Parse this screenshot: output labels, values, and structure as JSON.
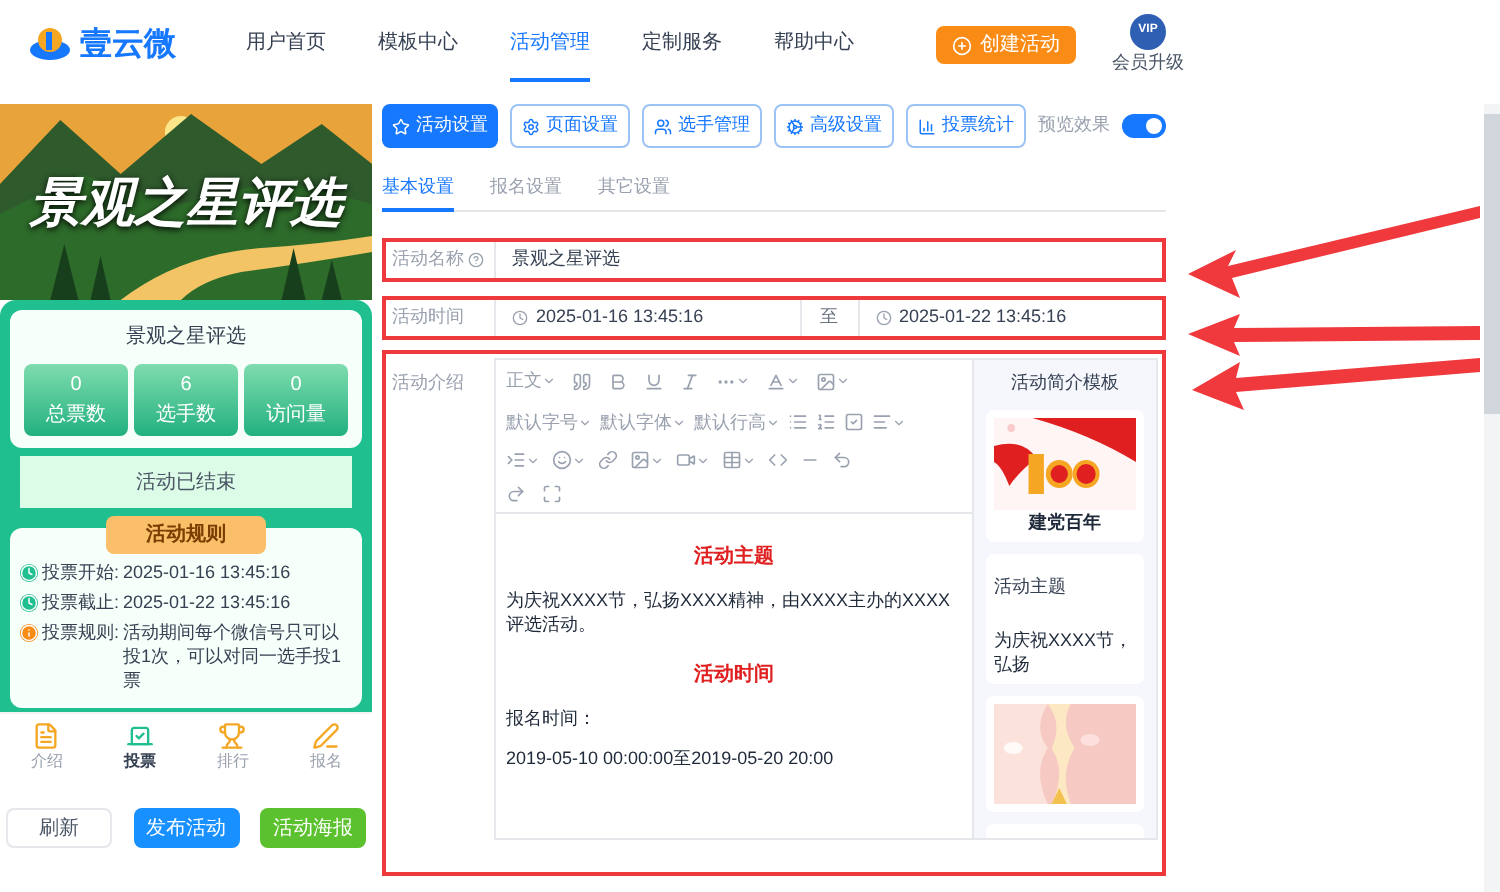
{
  "header": {
    "logo_text": "壹云微",
    "nav": [
      {
        "label": "用户首页",
        "selected": false
      },
      {
        "label": "模板中心",
        "selected": false
      },
      {
        "label": "活动管理",
        "selected": true
      },
      {
        "label": "定制服务",
        "selected": false
      },
      {
        "label": "帮助中心",
        "selected": false
      }
    ],
    "create_button": "创建活动",
    "vip_badge": "VIP",
    "vip_label": "会员升级"
  },
  "preview": {
    "banner_title": "景观之星评选",
    "card_title": "景观之星评选",
    "stats": [
      {
        "value": "0",
        "label": "总票数"
      },
      {
        "value": "6",
        "label": "选手数"
      },
      {
        "value": "0",
        "label": "访问量"
      }
    ],
    "status": "活动已结束",
    "rules_heading": "活动规则",
    "rules": [
      {
        "kind": "time",
        "label": "投票开始:",
        "value": "2025-01-16 13:45:16"
      },
      {
        "kind": "time",
        "label": "投票截止:",
        "value": "2025-01-22 13:45:16"
      },
      {
        "kind": "info",
        "label": "投票规则:",
        "value": "活动期间每个微信号只可以投1次，可以对同一选手投1票"
      }
    ],
    "bottom_nav": [
      {
        "label": "介绍",
        "selected": false
      },
      {
        "label": "投票",
        "selected": true
      },
      {
        "label": "排行",
        "selected": false
      },
      {
        "label": "报名",
        "selected": false
      }
    ],
    "buttons": [
      {
        "kind": "plain",
        "label": "刷新"
      },
      {
        "kind": "primary",
        "label": "发布活动"
      },
      {
        "kind": "success",
        "label": "活动海报"
      }
    ]
  },
  "tabs": [
    {
      "label": "活动设置",
      "selected": true
    },
    {
      "label": "页面设置",
      "selected": false
    },
    {
      "label": "选手管理",
      "selected": false
    },
    {
      "label": "高级设置",
      "selected": false
    },
    {
      "label": "投票统计",
      "selected": false
    }
  ],
  "preview_toggle": {
    "label": "预览效果",
    "on": true
  },
  "subtabs": [
    {
      "label": "基本设置",
      "selected": true
    },
    {
      "label": "报名设置",
      "selected": false
    },
    {
      "label": "其它设置",
      "selected": false
    }
  ],
  "form": {
    "name_label": "活动名称",
    "name_value": "景观之星评选",
    "time_label": "活动时间",
    "start": "2025-01-16 13:45:16",
    "separator": "至",
    "end": "2025-01-22 13:45:16",
    "intro_label": "活动介绍"
  },
  "editor": {
    "dropdowns": [
      "正文",
      "默认字号",
      "默认字体",
      "默认行高"
    ],
    "content": [
      {
        "kind": "heading",
        "text": "活动主题"
      },
      {
        "kind": "paragraph",
        "text": "为庆祝XXXX节，弘扬XXXX精神，由XXXX主办的XXXX评选活动。"
      },
      {
        "kind": "heading",
        "text": "活动时间"
      },
      {
        "kind": "paragraph",
        "text": "报名时间："
      },
      {
        "kind": "paragraph",
        "text": "2019-05-10 00:00:00至2019-05-20 20:00"
      }
    ]
  },
  "templates": {
    "title": "活动简介模板",
    "items": [
      {
        "kind": "picture",
        "caption": "建党百年"
      },
      {
        "kind": "text",
        "heading": "活动主题",
        "caption": "为庆祝XXXX节，弘扬"
      },
      {
        "kind": "picture"
      },
      {
        "kind": "empty"
      }
    ]
  }
}
